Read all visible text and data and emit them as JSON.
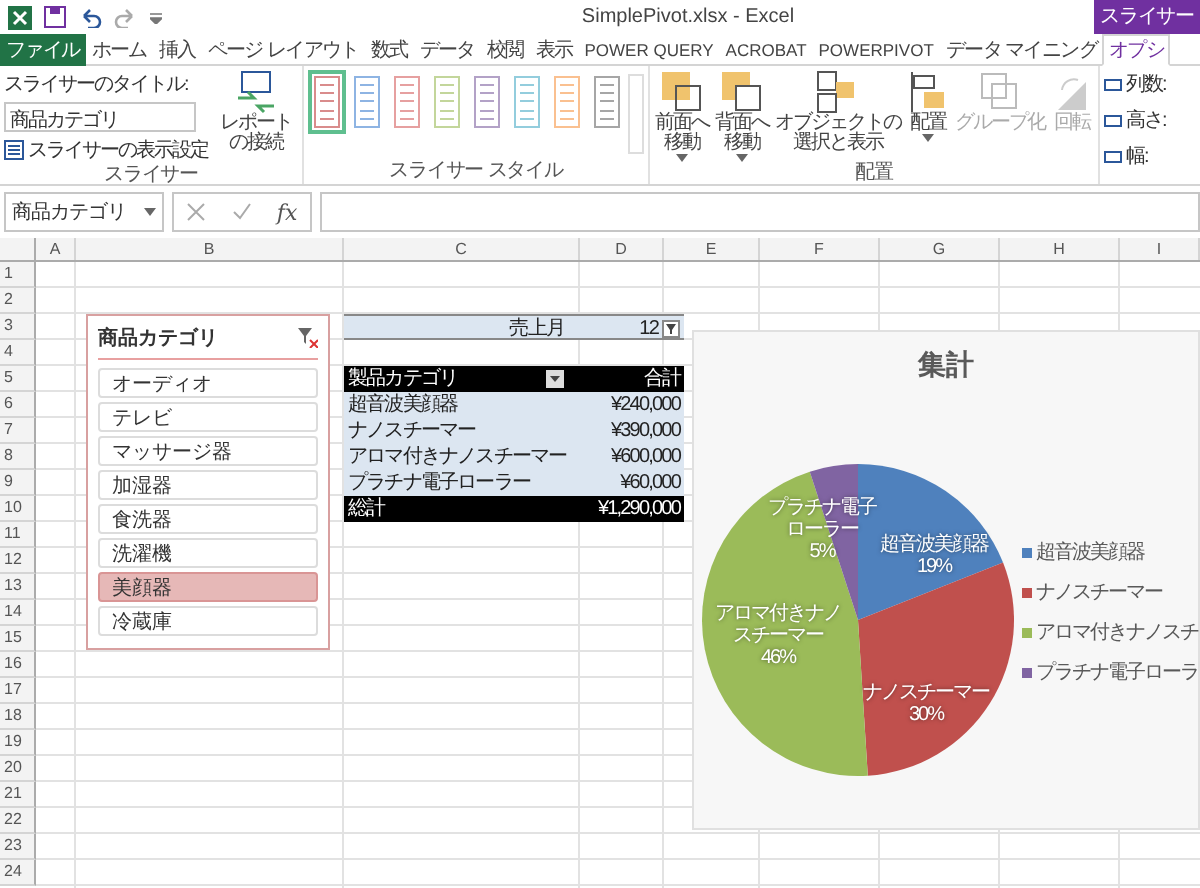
{
  "title_bar": {
    "title": "SimplePivot.xlsx - Excel",
    "context_tab": "スライサー"
  },
  "tabs": [
    {
      "label": "ファイル",
      "kind": "file",
      "selected": false
    },
    {
      "label": "ホーム",
      "kind": "tab",
      "selected": false
    },
    {
      "label": "挿入",
      "kind": "tab",
      "selected": false
    },
    {
      "label": "ページ レイアウト",
      "kind": "tab",
      "selected": false
    },
    {
      "label": "数式",
      "kind": "tab",
      "selected": false
    },
    {
      "label": "データ",
      "kind": "tab",
      "selected": false
    },
    {
      "label": "校閲",
      "kind": "tab",
      "selected": false
    },
    {
      "label": "表示",
      "kind": "tab",
      "selected": false
    },
    {
      "label": "POWER QUERY",
      "kind": "tab",
      "selected": false
    },
    {
      "label": "ACROBAT",
      "kind": "tab",
      "selected": false
    },
    {
      "label": "POWERPIVOT",
      "kind": "tab",
      "selected": false
    },
    {
      "label": "データ マイニング",
      "kind": "tab",
      "selected": false
    },
    {
      "label": "オプシ",
      "kind": "tab",
      "selected": true
    }
  ],
  "ribbon": {
    "slicer_group": {
      "caption_label": "スライサーのタイトル:",
      "caption_value": "商品カテゴリ",
      "settings": "スライサーの表示設定",
      "connections": "レポートの接続",
      "label": "スライサー"
    },
    "styles_group": {
      "label": "スライサー スタイル",
      "styles": [
        {
          "color": "#d98c8c",
          "selected": true
        },
        {
          "color": "#8eb4e3",
          "selected": false
        },
        {
          "color": "#e6a0a0",
          "selected": false
        },
        {
          "color": "#c3d69b",
          "selected": false
        },
        {
          "color": "#b3a2c7",
          "selected": false
        },
        {
          "color": "#93cddd",
          "selected": false
        },
        {
          "color": "#fac090",
          "selected": false
        },
        {
          "color": "#a6a6a6",
          "selected": false
        }
      ]
    },
    "arrange_group": {
      "label": "配置",
      "buttons": [
        {
          "label": "前面へ移動",
          "kind": "front",
          "disabled": false
        },
        {
          "label": "背面へ移動",
          "kind": "back",
          "disabled": false
        },
        {
          "label": "オブジェクトの選択と表示",
          "kind": "pane",
          "disabled": false
        },
        {
          "label": "配置",
          "kind": "align",
          "disabled": false
        },
        {
          "label": "グループ化",
          "kind": "group",
          "disabled": true
        },
        {
          "label": "回転",
          "kind": "rotate",
          "disabled": true
        }
      ]
    },
    "size_group": {
      "items": [
        "列数:",
        "高さ:",
        "幅:"
      ]
    }
  },
  "formula_bar": {
    "name_box": "商品カテゴリ",
    "function_label": "fx"
  },
  "sheet": {
    "columns": [
      "A",
      "B",
      "C",
      "D",
      "E",
      "F",
      "G",
      "H",
      "I"
    ],
    "rows": [
      "1",
      "2",
      "3",
      "4",
      "5",
      "6",
      "7",
      "8",
      "9",
      "10",
      "11",
      "12",
      "13",
      "14",
      "15",
      "16",
      "17",
      "18",
      "19",
      "20",
      "21",
      "22",
      "23",
      "24"
    ]
  },
  "slicer": {
    "title": "商品カテゴリ",
    "items": [
      {
        "label": "オーディオ",
        "selected": false
      },
      {
        "label": "テレビ",
        "selected": false
      },
      {
        "label": "マッサージ器",
        "selected": false
      },
      {
        "label": "加湿器",
        "selected": false
      },
      {
        "label": "食洗器",
        "selected": false
      },
      {
        "label": "洗濯機",
        "selected": false
      },
      {
        "label": "美顔器",
        "selected": true
      },
      {
        "label": "冷蔵庫",
        "selected": false
      }
    ]
  },
  "pivot": {
    "filter_label": "売上月",
    "filter_value": "12",
    "header": [
      "製品カテゴリ",
      "合計"
    ],
    "rows": [
      {
        "category": "超音波美顔器",
        "amount": "¥240,000"
      },
      {
        "category": "ナノスチーマー",
        "amount": "¥390,000"
      },
      {
        "category": "アロマ付きナノスチーマー",
        "amount": "¥600,000"
      },
      {
        "category": "プラチナ電子ローラー",
        "amount": "¥60,000"
      }
    ],
    "total": {
      "label": "総計",
      "amount": "¥1,290,000"
    }
  },
  "chart": {
    "chart_data": {
      "type": "pie",
      "title": "集計",
      "categories": [
        "超音波美顔器",
        "ナノスチーマー",
        "アロマ付きナノスチーマー",
        "プラチナ電子ローラー"
      ],
      "values": [
        19,
        30,
        46,
        5
      ],
      "value_labels": [
        "19%",
        "30%",
        "46%",
        "5%"
      ]
    },
    "legend": [
      {
        "label": "超音波美顔器",
        "color": "#4f81bd"
      },
      {
        "label": "ナノスチーマー",
        "color": "#c0504d"
      },
      {
        "label": "アロマ付きナノスチ",
        "color": "#9bbb59"
      },
      {
        "label": "プラチナ電子ローラ",
        "color": "#8064a2"
      }
    ]
  }
}
